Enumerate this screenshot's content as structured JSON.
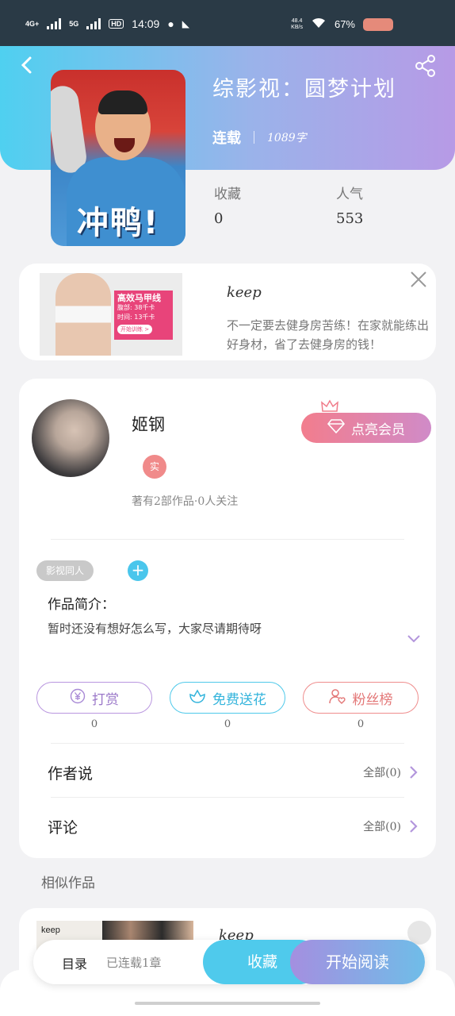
{
  "status_bar": {
    "network1": "4G+",
    "network2": "5G",
    "hd": "HD",
    "time": "14:09",
    "speed_top": "48.4",
    "speed_bottom": "KB/s",
    "battery": "67%"
  },
  "book": {
    "title": "综影视：圆梦计划",
    "status": "连载",
    "word_count": "1089字",
    "cover_text": "冲鸭!",
    "stats": [
      {
        "label": "收藏",
        "value": "0"
      },
      {
        "label": "人气",
        "value": "553"
      }
    ]
  },
  "ad": {
    "title": "keep",
    "description": "不一定要去健身房苦练！在家就能练出好身材，省了去健身房的钱！",
    "image_headline": "高效马甲线",
    "image_line1": "腹部: 38千卡",
    "image_line2": "时间: 13千卡",
    "image_button": "开始训练 >"
  },
  "author": {
    "name": "姬钢",
    "verified_label": "实",
    "vip_button": "点亮会员",
    "meta": "著有2部作品·0人关注",
    "category": "影视同人",
    "add_symbol": "+",
    "intro_label": "作品简介：",
    "intro_text": "暂时还没有想好怎么写，大家尽请期待呀"
  },
  "actions": [
    {
      "label": "打赏",
      "count": "0"
    },
    {
      "label": "免费送花",
      "count": "0"
    },
    {
      "label": "粉丝榜",
      "count": "0"
    }
  ],
  "sections": {
    "author_says": {
      "title": "作者说",
      "all": "全部(0)"
    },
    "comments": {
      "title": "评论",
      "all": "全部(0)"
    },
    "similar": "相似作品"
  },
  "similar_item": {
    "title": "keep",
    "image_brand": "keep"
  },
  "bottom_bar": {
    "toc": "目录",
    "progress": "已连载1章",
    "collect": "收藏",
    "read": "开始阅读"
  },
  "colors": {
    "header_start": "#4fd0f0",
    "header_end": "#b79ae6",
    "accent_blue": "#4fcaec",
    "accent_purple": "#a48fe0",
    "vip_pink": "#f27d8d"
  }
}
